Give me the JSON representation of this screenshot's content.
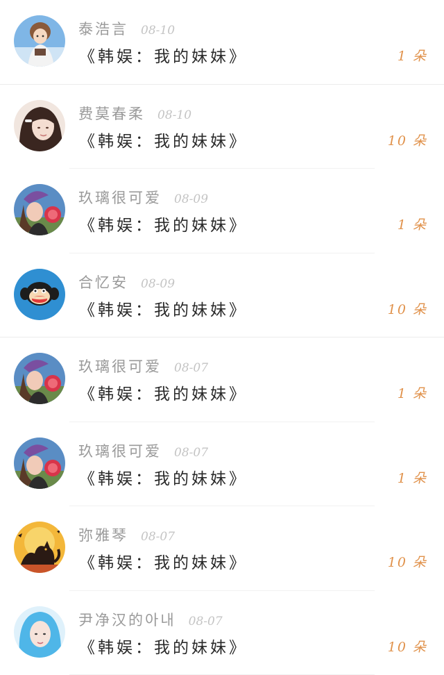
{
  "gift_records": [
    {
      "username": "泰浩言",
      "date": "08-10",
      "message": "《韩娱：我的妹妹》",
      "count": "1 朵",
      "avatar": "anime-boy-avatar"
    },
    {
      "username": "费莫春柔",
      "date": "08-10",
      "message": "《韩娱：我的妹妹》",
      "count": "10 朵",
      "avatar": "girl-portrait-avatar"
    },
    {
      "username": "玖璃很可爱",
      "date": "08-09",
      "message": "《韩娱：我的妹妹》",
      "count": "1 朵",
      "avatar": "girl-hat-avatar"
    },
    {
      "username": "合忆安",
      "date": "08-09",
      "message": "《韩娱：我的妹妹》",
      "count": "10 朵",
      "avatar": "monkey-avatar"
    },
    {
      "username": "玖璃很可爱",
      "date": "08-07",
      "message": "《韩娱：我的妹妹》",
      "count": "1 朵",
      "avatar": "girl-hat-avatar"
    },
    {
      "username": "玖璃很可爱",
      "date": "08-07",
      "message": "《韩娱：我的妹妹》",
      "count": "1 朵",
      "avatar": "girl-hat-avatar"
    },
    {
      "username": "弥雅琴",
      "date": "08-07",
      "message": "《韩娱：我的妹妹》",
      "count": "10 朵",
      "avatar": "black-cat-avatar"
    },
    {
      "username": "尹净汉的아내",
      "date": "08-07",
      "message": "《韩娱：我的妹妹》",
      "count": "10 朵",
      "avatar": "blue-hair-girl-avatar"
    }
  ],
  "colors": {
    "username": "#9a9a9a",
    "date": "#c4c4c4",
    "message": "#2a2a2a",
    "count_accent": "#e0914a"
  }
}
